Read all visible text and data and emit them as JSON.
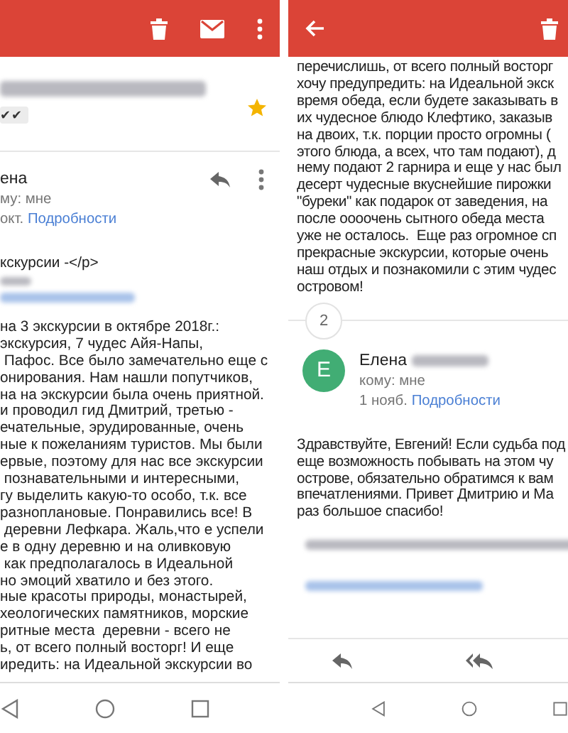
{
  "screens": [
    {
      "kind": "thread_top",
      "starred": true,
      "label": "✔✔",
      "sender": {
        "name": "ена",
        "to": "му: мне",
        "date": "окт.",
        "details_link": "Подробности"
      },
      "quoted_line": "кскурсии -</p>",
      "body_lines": [
        "на 3 экскурсии в октябре 2018г.:",
        "экскурсия, 7 чудес Айя-Напы,",
        " Пафос. Все было замечательно еще с",
        "онирования. Нам нашли попутчиков,",
        "на на экскурсии была очень приятной.",
        "и проводил гид Дмитрий, третью -",
        "ечательные, эрудированные, очень",
        "ные к пожеланиям туристов. Мы были",
        "ервые, поэтому для нас все экскурсии",
        " познавательными и интересными,",
        "гу выделить какую-то особо, т.к. все",
        "разноплановые. Понравились все! В",
        " деревни Лефкара. Жаль,что е успели",
        "е в одну деревню и на оливковую",
        " как предполагалось в Идеальной",
        "но эмоций хватило и без этого.",
        "ные красоты природы, монастырей,",
        "хеологических памятников, морские",
        "ритные места  деревни - всего не",
        "ь, от всего полный восторг! И еще",
        "иредить: на Идеальной экскурсии во"
      ]
    },
    {
      "kind": "thread_continued",
      "body_lines": [
        "перечислишь, от всего полный восторг",
        "хочу предупредить: на Идеальной экск",
        "время обеда, если будете заказывать в",
        "их чудесное блюдо Клефтико, заказыв",
        "на двоих, т.к. порции просто огромны (",
        "этого блюда, а всех, что там подают), д",
        "нему подают 2 гарнира и еще у нас был",
        "десерт чудесные вкуснейшие пирожки",
        "\"буреки\" как подарок от заведения, на",
        "после оооочень сытного обеда места",
        "уже не осталось.  Еще раз огромное сп",
        "прекрасные экскурсии, которые очень",
        "наш отдых и познакомили с этим чудес",
        "островом!"
      ],
      "collapsed_count": "2",
      "sender": {
        "avatar_letter": "Е",
        "name": "Елена",
        "to": "кому: мне",
        "date": "1 нояб.",
        "details_link": "Подробности"
      },
      "reply_lines": [
        "Здравствуйте, Евгений! Если судьба под",
        "еще возможность побывать на этом чу",
        "острове, обязательно обратимся к вам",
        "впечатлениями. Привет Дмитрию и Ма",
        "раз большое спасибо!"
      ]
    }
  ]
}
